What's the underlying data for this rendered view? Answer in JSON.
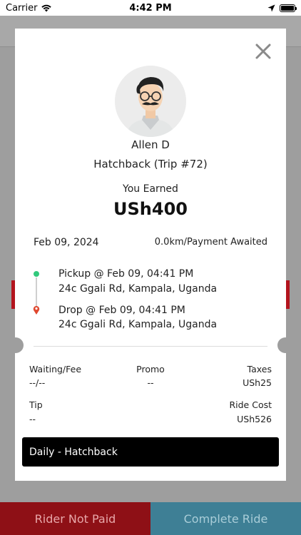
{
  "status_bar": {
    "carrier": "Carrier",
    "time": "4:42 PM"
  },
  "modal": {
    "driver_name": "Allen D",
    "vehicle": "Hatchback (Trip #72)",
    "earned_label": "You Earned",
    "earned_amount": "USh400",
    "date": "Feb 09, 2024",
    "distance_status": "0.0km/Payment Awaited",
    "pickup": {
      "title": "Pickup @ Feb 09, 04:41 PM",
      "address": "24c Ggali Rd, Kampala, Uganda"
    },
    "drop": {
      "title": "Drop @ Feb 09, 04:41 PM",
      "address": "24c Ggali Rd, Kampala, Uganda"
    },
    "fares": {
      "waiting_label": "Waiting/Fee",
      "waiting_value": "--/--",
      "promo_label": "Promo",
      "promo_value": "--",
      "taxes_label": "Taxes",
      "taxes_value": "USh25",
      "tip_label": "Tip",
      "tip_value": "--",
      "ride_cost_label": "Ride Cost",
      "ride_cost_value": "USh526"
    },
    "plan": "Daily - Hatchback"
  },
  "bottom_bar": {
    "not_paid": "Rider Not Paid",
    "complete": "Complete Ride"
  },
  "colors": {
    "pickup_dot": "#32c97c",
    "drop_pin": "#e0482f",
    "not_paid_bg": "#8e1016",
    "complete_bg": "#3e7f95"
  },
  "icons": {
    "close": "close-icon",
    "wifi": "wifi-icon",
    "location": "location-arrow-icon",
    "battery": "battery-icon"
  }
}
